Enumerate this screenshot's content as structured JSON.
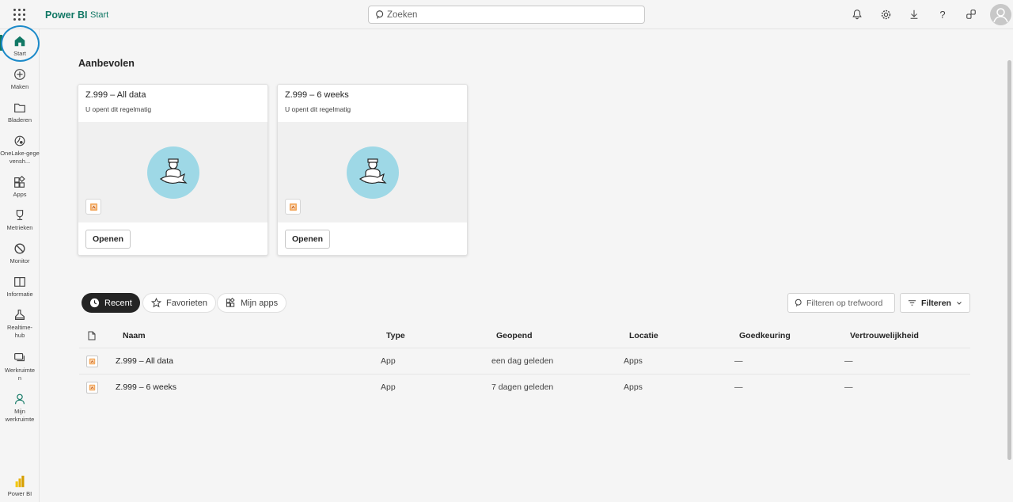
{
  "topbar": {
    "brand": "Power BI",
    "breadcrumb": "Start",
    "search_placeholder": "Zoeken"
  },
  "leftnav": {
    "items": [
      {
        "label": "Start",
        "icon": "home-icon"
      },
      {
        "label": "Maken",
        "icon": "plus-circle-icon"
      },
      {
        "label": "Bladeren",
        "icon": "folder-icon"
      },
      {
        "label": "OneLake-gegevensh...",
        "icon": "onelake-icon"
      },
      {
        "label": "Apps",
        "icon": "apps-icon"
      },
      {
        "label": "Metrieken",
        "icon": "trophy-icon"
      },
      {
        "label": "Monitor",
        "icon": "monitor-icon"
      },
      {
        "label": "Informatie",
        "icon": "book-icon"
      },
      {
        "label": "Realtime-hub",
        "icon": "realtime-icon"
      },
      {
        "label": "Werkruimten",
        "icon": "workspaces-icon"
      },
      {
        "label": "Mijn werkruimte",
        "icon": "person-icon"
      }
    ],
    "footer_label": "Power BI"
  },
  "recommended": {
    "title": "Aanbevolen",
    "cards": [
      {
        "title": "Z.999 – All data",
        "subtitle": "U opent dit regelmatig",
        "button": "Openen"
      },
      {
        "title": "Z.999 – 6 weeks",
        "subtitle": "U opent dit regelmatig",
        "button": "Openen"
      }
    ]
  },
  "tabs": [
    {
      "label": "Recent",
      "active": true
    },
    {
      "label": "Favorieten",
      "active": false
    },
    {
      "label": "Mijn apps",
      "active": false
    }
  ],
  "filter": {
    "placeholder": "Filteren op trefwoord",
    "button": "Filteren"
  },
  "table": {
    "columns": [
      "Naam",
      "Type",
      "Geopend",
      "Locatie",
      "Goedkeuring",
      "Vertrouwelijkheid"
    ],
    "rows": [
      {
        "name": "Z.999 – All data",
        "type": "App",
        "opened": "een dag geleden",
        "location": "Apps",
        "approval": "—",
        "sensitivity": "—"
      },
      {
        "name": "Z.999 – 6 weeks",
        "type": "App",
        "opened": "7 dagen geleden",
        "location": "Apps",
        "approval": "—",
        "sensitivity": "—"
      }
    ]
  },
  "colors": {
    "brand": "#117865",
    "highlight_ring": "#1c8ac9",
    "card_circle": "#9ed8e6"
  }
}
